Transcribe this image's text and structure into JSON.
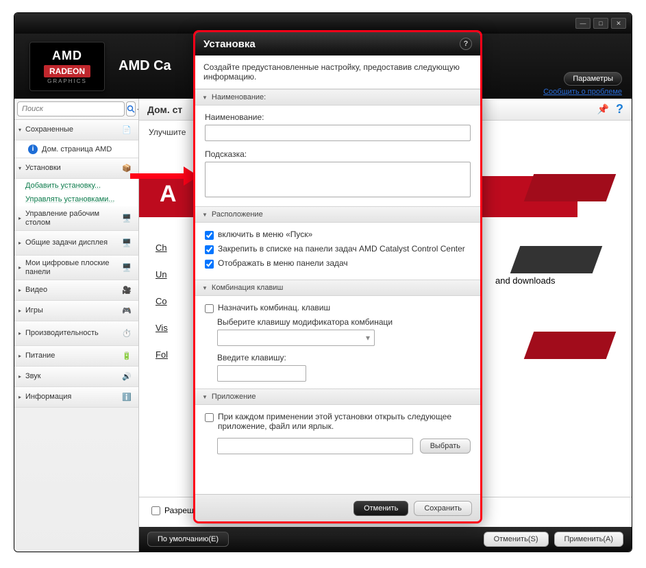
{
  "window": {
    "app_title": "AMD Ca",
    "logo_brand": "AMD",
    "logo_product": "RADEON",
    "logo_sub": "GRAPHICS",
    "parameters_btn": "Параметры",
    "report_link": "Сообщить о проблеме"
  },
  "search": {
    "placeholder": "Поиск"
  },
  "sidebar": {
    "saved": "Сохраненные",
    "amd_home": "Дом. страница AMD",
    "installs": "Установки",
    "add_install": "Добавить установку...",
    "manage_installs": "Управлять установками...",
    "desktop_mgmt": "Управление рабочим столом",
    "display_tasks": "Общие задачи дисплея",
    "flat_panels": "Мои цифровые плоские панели",
    "video": "Видео",
    "games": "Игры",
    "performance": "Производительность",
    "power": "Питание",
    "audio": "Звук",
    "information": "Информация"
  },
  "main": {
    "title": "Дом. ст",
    "subtitle": "Улучшите",
    "banner_a": "A",
    "link_ch": "Ch",
    "link_un": "Un",
    "link_co": "Co",
    "link_vis": "Vis",
    "link_fol": "Fol",
    "downloads_tail": "and downloads",
    "allow_label": "Разреш",
    "defaults_btn": "По умолчанию(E)",
    "cancel_btn": "Отменить(S)",
    "apply_btn": "Применить(A)"
  },
  "modal": {
    "title": "Установка",
    "description": "Создайте предустановленные настройку, предоставив следующую информацию.",
    "sect_name": "Наименование:",
    "label_name": "Наименование:",
    "label_hint": "Подсказка:",
    "sect_location": "Расположение",
    "chk_start_menu": "включить в меню «Пуск»",
    "chk_taskbar_pin": "Закрепить в списке на панели задач AMD Catalyst Control Center",
    "chk_taskbar_menu": "Отображать в меню панели задач",
    "sect_hotkey": "Комбинация клавиш",
    "chk_assign_hotkey": "Назначить комбинац. клавиш",
    "label_modifier": "Выберите клавишу модификатора комбинаци",
    "label_key": "Введите клавишу:",
    "sect_app": "Приложение",
    "chk_open_app": "При каждом применении этой установки открыть следующее приложение, файл или ярлык.",
    "browse_btn": "Выбрать",
    "cancel_btn": "Отменить",
    "save_btn": "Сохранить"
  }
}
